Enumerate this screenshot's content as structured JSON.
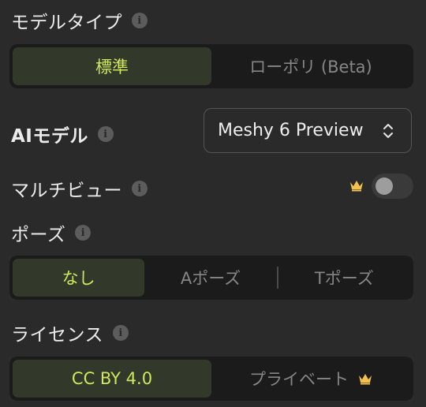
{
  "model_type": {
    "label": "モデルタイプ",
    "options": [
      "標準",
      "ローポリ (Beta)"
    ],
    "selected": "標準"
  },
  "ai_model": {
    "label": "AIモデル",
    "value": "Meshy 6 Preview"
  },
  "multiview": {
    "label": "マルチビュー",
    "enabled": false
  },
  "pose": {
    "label": "ポーズ",
    "options": [
      "なし",
      "Aポーズ",
      "Tポーズ"
    ],
    "selected": "なし"
  },
  "license": {
    "label": "ライセンス",
    "options": [
      "CC BY 4.0",
      "プライベート"
    ],
    "selected": "CC BY 4.0"
  },
  "colors": {
    "background": "#2a2a2a",
    "accent_text": "#cfe85a",
    "accent_bg": "#33392a",
    "crown": "#f2c14e"
  },
  "icons": [
    "info-icon",
    "crown-icon",
    "chevron-up-down-icon"
  ]
}
